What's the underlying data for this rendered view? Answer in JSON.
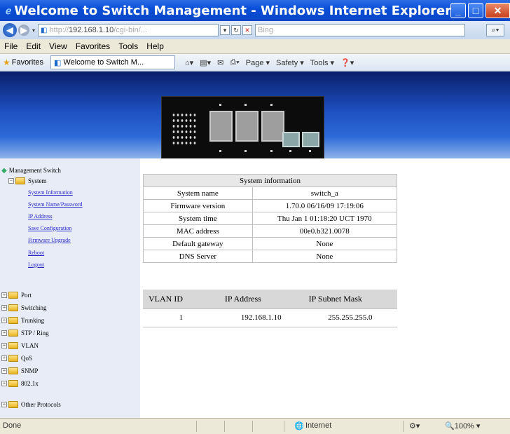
{
  "window": {
    "title": "Welcome to Switch Management - Windows Internet Explorer"
  },
  "address": {
    "url_prefix": "http://",
    "url_host": "192.168.1.10",
    "url_rest": "/cgi-bin/...",
    "search_placeholder": "Bing"
  },
  "menu": [
    "File",
    "Edit",
    "View",
    "Favorites",
    "Tools",
    "Help"
  ],
  "favorites": {
    "label": "Favorites",
    "tab_title": "Welcome to Switch M...",
    "tools": [
      "Page ▾",
      "Safety ▾",
      "Tools ▾"
    ]
  },
  "sidebar": {
    "root": "Management Switch",
    "system": "System",
    "system_links": [
      "System Information",
      "System Name/Password",
      "IP Address",
      "Save Configuration",
      "Firmware Upgrade",
      "Reboot",
      "Logout"
    ],
    "groups": [
      "Port",
      "Switching",
      "Trunking",
      "STP / Ring",
      "VLAN",
      "QoS",
      "SNMP",
      "802.1x",
      "Other Protocols"
    ]
  },
  "system_info": {
    "header": "System information",
    "rows": [
      {
        "label": "System name",
        "value": "switch_a"
      },
      {
        "label": "Firmware version",
        "value": "1.70.0 06/16/09 17:19:06"
      },
      {
        "label": "System time",
        "value": "Thu Jan 1 01:18:20 UCT 1970"
      },
      {
        "label": "MAC address",
        "value": "00e0.b321.0078"
      },
      {
        "label": "Default gateway",
        "value": "None"
      },
      {
        "label": "DNS Server",
        "value": "None"
      }
    ]
  },
  "vlan_table": {
    "headers": [
      "VLAN ID",
      "IP Address",
      "IP Subnet Mask"
    ],
    "rows": [
      [
        "1",
        "192.168.1.10",
        "255.255.255.0"
      ]
    ]
  },
  "status": {
    "left": "Done",
    "zone": "Internet",
    "zoom": "100%"
  }
}
